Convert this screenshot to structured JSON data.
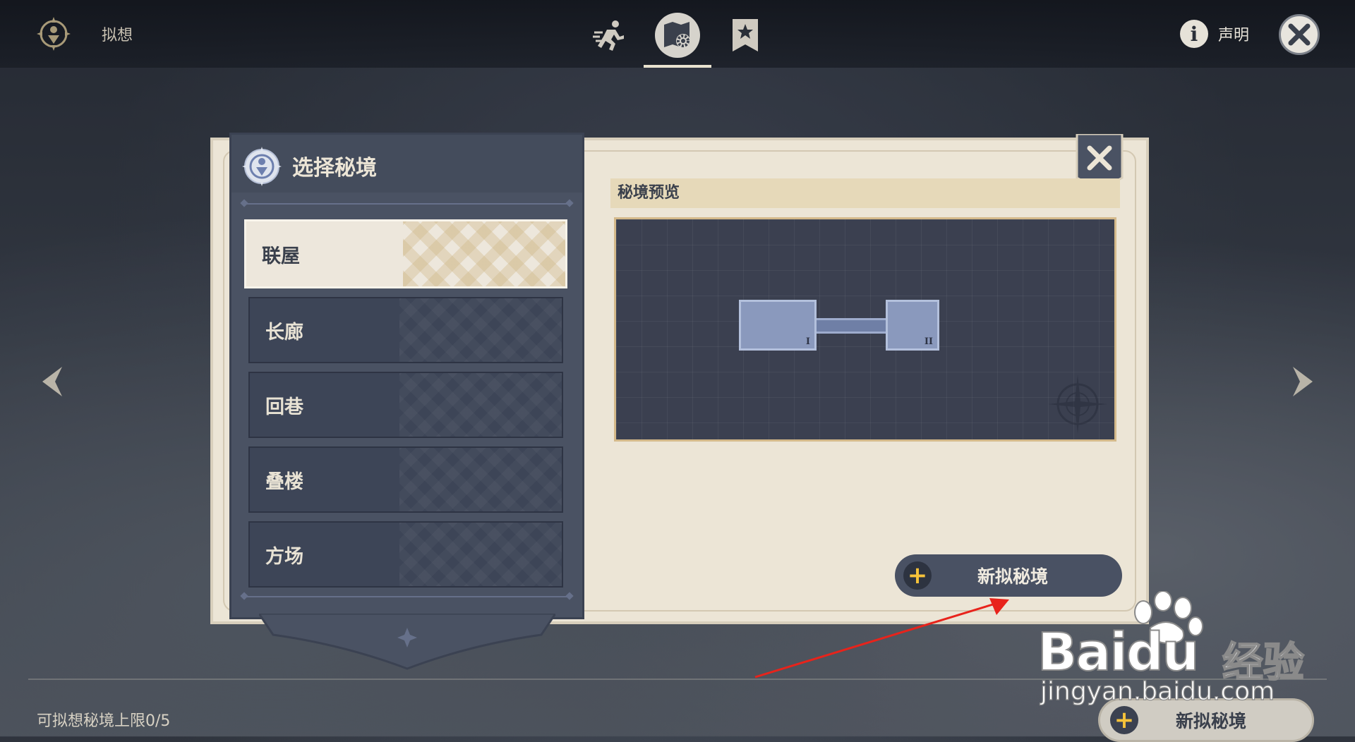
{
  "topbar": {
    "title": "拟想",
    "tabs": [
      "run-icon",
      "map-gear-icon",
      "bookmark-star-icon"
    ],
    "active_tab": "map-gear-icon",
    "declare_label": "声明"
  },
  "panel": {
    "title": "选择秘境",
    "items": [
      {
        "label": "联屋",
        "selected": true
      },
      {
        "label": "长廊",
        "selected": false
      },
      {
        "label": "回巷",
        "selected": false
      },
      {
        "label": "叠楼",
        "selected": false
      },
      {
        "label": "方场",
        "selected": false
      }
    ]
  },
  "preview": {
    "label": "秘境预览",
    "rooms": [
      "I",
      "II"
    ]
  },
  "new_button": {
    "label": "新拟秘境"
  },
  "footer": {
    "limit_text": "可拟想秘境上限0/5",
    "new_button_label": "新拟秘境"
  },
  "watermark": {
    "brand": "Baidu",
    "sub": "经验",
    "url": "jingyan.baidu.com"
  },
  "colors": {
    "panel_dark": "#4a5263",
    "paper": "#ece5d6",
    "accent_gold": "#f5c23a",
    "annotation_red": "#e8231b"
  }
}
